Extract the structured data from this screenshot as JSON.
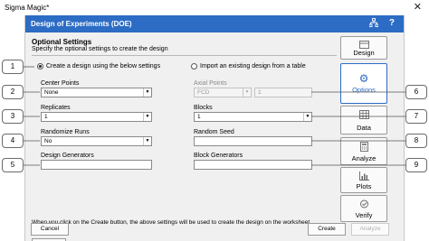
{
  "window": {
    "title": "Sigma Magic*",
    "close_glyph": "✕"
  },
  "dialog": {
    "title": "Design of Experiments (DOE)"
  },
  "section": {
    "title": "Optional Settings",
    "subtitle": "Specify the optional settings to create the design"
  },
  "options": {
    "create_radio": "Create a design using the below settings",
    "import_radio": "Import an existing design from a table"
  },
  "fields": {
    "center_points": {
      "label": "Center Points",
      "value": "None"
    },
    "axial_points": {
      "label": "Axial Points",
      "value": "FCD",
      "extra_value": "1"
    },
    "replicates": {
      "label": "Replicates",
      "value": "1"
    },
    "blocks": {
      "label": "Blocks",
      "value": "1"
    },
    "randomize": {
      "label": "Randomize Runs",
      "value": "No"
    },
    "random_seed": {
      "label": "Random Seed",
      "value": ""
    },
    "design_generators": {
      "label": "Design Generators",
      "value": ""
    },
    "block_generators": {
      "label": "Block Generators",
      "value": ""
    }
  },
  "note": "When you click on the Create button, the above settings will be used to create the design on the worksheet",
  "buttons": {
    "cancel": "Cancel",
    "create": "Create",
    "analyze": "Analyze"
  },
  "sidebar": [
    {
      "label": "Design",
      "icon": "design-icon",
      "active": false
    },
    {
      "label": "Options",
      "icon": "gear-icon",
      "active": true
    },
    {
      "label": "Data",
      "icon": "table-icon",
      "active": false
    },
    {
      "label": "Analyze",
      "icon": "calculator-icon",
      "active": false
    },
    {
      "label": "Plots",
      "icon": "chart-icon",
      "active": false
    },
    {
      "label": "Verify",
      "icon": "verify-icon",
      "active": false
    }
  ],
  "callouts": [
    "1",
    "2",
    "3",
    "4",
    "5",
    "6",
    "7",
    "8",
    "9"
  ],
  "colors": {
    "header": "#2c6cc4",
    "accent": "#2c6cc4"
  }
}
